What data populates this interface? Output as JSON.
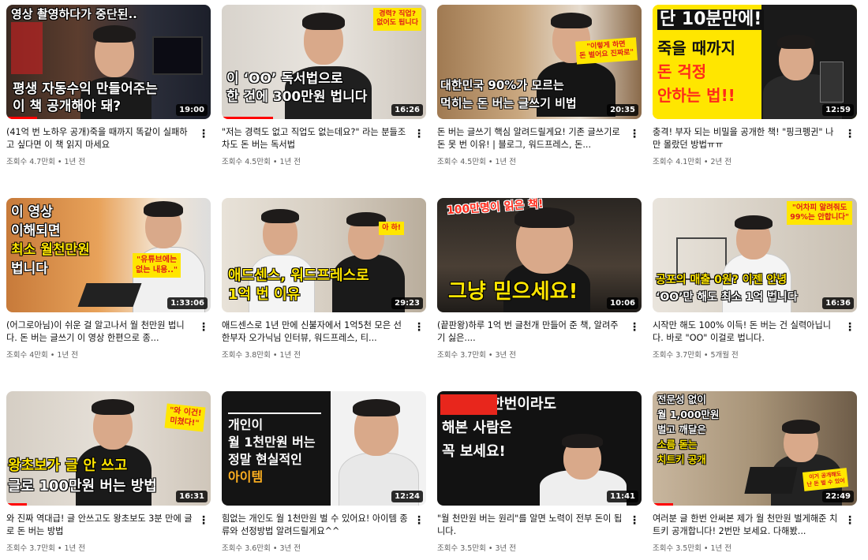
{
  "videos": [
    {
      "overlay": [
        "영상 촬영하다가 중단된..",
        "평생 자동수익 만들어주는",
        "이 책 공개해야 돼?"
      ],
      "duration": "19:00",
      "title": "(41억 번 노하우 공개)죽을 때까지 똑같이 실패하고 싶다면 이 책 읽지 마세요",
      "stats": "조회수 4.7만회 • 1년 전",
      "watched": 0.15
    },
    {
      "overlay": [
        "이 ‘OO’ 독서법으로",
        "한 건에 300만원 법니다"
      ],
      "badge": "경력? 직업?\n없어도 됩니다",
      "duration": "16:26",
      "title": "\"저는 경력도 없고 직업도 없는데요?\" 라는 분들조차도 돈 버는 독서법",
      "stats": "조회수 4.5만회 • 1년 전",
      "watched": 0.25
    },
    {
      "overlay": [
        "대한민국 90%가 모르는",
        "먹히는 돈 버는 글쓰기 비법"
      ],
      "badge": "\"이렇게 하면\n돈 벌어요 진짜로\"",
      "duration": "20:35",
      "title": "돈 버는 글쓰기 핵심 알려드릴게요! 기존 글쓰기로 돈 못 번 이유! | 블로그, 워드프레스, 돈...",
      "stats": "조회수 4.5만회 • 1년 전",
      "watched": 0.0
    },
    {
      "overlay": [
        "단 10분만에!",
        "죽을 때까지",
        "돈 걱정",
        "안하는 법!!"
      ],
      "duration": "12:59",
      "title": "충격! 부자 되는 비밀을 공개한 책! \"핑크펭귄\" 나만 몰랐던 방법ㅠㅠ",
      "stats": "조회수 4.1만회 • 2년 전",
      "watched": 0.0
    },
    {
      "overlay": [
        "이 영상",
        "이해되면",
        "최소 월천만원",
        "법니다"
      ],
      "badge": "\"유튜브에는\n없는 내용..\"",
      "duration": "1:33:06",
      "title": "(어그로아님)이 쉬운 걸 알고나서 월 천만원 법니다. 돈 버는 글쓰기 이 영상 한편으로 종...",
      "stats": "조회수 4만회 • 1년 전",
      "watched": 0.0
    },
    {
      "overlay": [
        "애드센스, 워드프레스로",
        "1억 번 이유"
      ],
      "badge": "아 하!",
      "duration": "29:23",
      "title": "애드센스로 1년 만에 신불자에서 1억5천 모은 선한부자 오가닉님 인터뷰, 워드프레스, 티...",
      "stats": "조회수 3.8만회 • 1년 전",
      "watched": 0.0
    },
    {
      "overlay": [
        "100만명이 읽은 책!",
        "그냥 믿으세요!"
      ],
      "duration": "10:06",
      "title": "(끝판왕)하루 1억 번 글천개 만들어 준 책, 알려주기 싫은....",
      "stats": "조회수 3.7만회 • 3년 전",
      "watched": 0.0
    },
    {
      "overlay": [
        "공포의 매출 0원? 이젠 안녕",
        "‘OO’만 해도 최소 1억 법니다"
      ],
      "badge": "\"어차피 알려줘도\n99%는 안합니다\"",
      "duration": "16:36",
      "title": "시작만 해도 100% 이득! 돈 버는 건 실력아닙니다. 바로 \"OO\" 이걸로 법니다.",
      "stats": "조회수 3.7만회 • 5개월 전",
      "watched": 0.0
    },
    {
      "overlay": [
        "왕초보가 글 안 쓰고",
        "글로 100만원 버는 방법"
      ],
      "badge": "\"와 이건!\n미쳤다!\"",
      "duration": "16:31",
      "title": "와 진짜 역대급! 글 안쓰고도 왕초보도 3분 만에 글로 돈 버는 방법",
      "stats": "조회수 3.7만회 • 1년 전",
      "watched": 0.1
    },
    {
      "overlay": [
        "개인이",
        "월 1천만원 버는",
        "정말 현실적인",
        "아이템"
      ],
      "duration": "12:24",
      "title": "힘없는 개인도 월 1천만원 벌 수 있어요! 아이템 종류와 선정방법 알려드릴게요^^",
      "stats": "조회수 3.6만회 • 3년 전",
      "watched": 0.0
    },
    {
      "overlay": [
        "돈 걱정 한번이라도",
        "해본 사람은",
        "꼭 보세요!"
      ],
      "duration": "11:41",
      "title": "\"월 천만원 버는 원리\"를 알면 노력이 전부 돈이 됩니다.",
      "stats": "조회수 3.5만회 • 3년 전",
      "watched": 0.0
    },
    {
      "overlay": [
        "전문성 없이",
        "월 1,000만원",
        "벌고 깨달은",
        "소름 돋는",
        "치트키 공개"
      ],
      "badge": "이거 공개해도\n난 돈 벌 수 있어",
      "duration": "22:49",
      "title": "여러분 글 한번 안써본 제가 월 천만원 벌게해준 치트키 공개합니다! 2번만 보세요. 다해봤...",
      "stats": "조회수 3.5만회 • 1년 전",
      "watched": 0.1
    }
  ],
  "menu_icon": "⋮",
  "colors": {
    "progress": "#ff0000",
    "stats": "#606060",
    "duration_bg": "#000000"
  }
}
